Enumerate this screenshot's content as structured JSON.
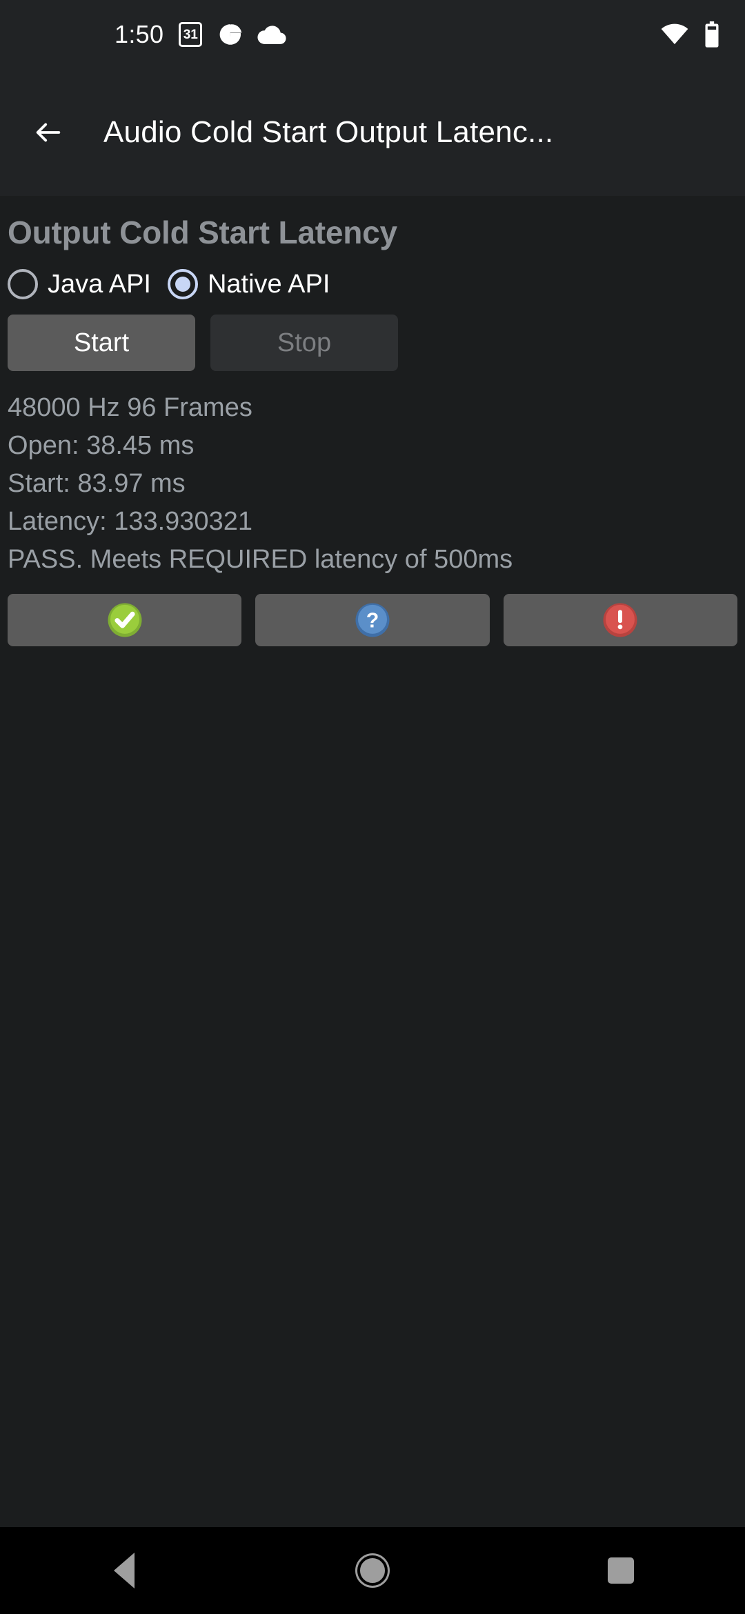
{
  "status_bar": {
    "clock": "1:50",
    "calendar_day": "31",
    "icons": [
      "calendar-icon",
      "google-icon",
      "cloud-icon",
      "wifi-icon",
      "battery-icon"
    ]
  },
  "app_bar": {
    "back_icon": "arrow-back-icon",
    "title": "Audio Cold Start Output Latenc..."
  },
  "main": {
    "heading": "Output Cold Start Latency",
    "radio_group": {
      "selected": "Native API",
      "options": [
        {
          "label": "Java API",
          "selected": false
        },
        {
          "label": "Native API",
          "selected": true
        }
      ]
    },
    "buttons": [
      {
        "label": "Start",
        "enabled": true
      },
      {
        "label": "Stop",
        "enabled": false
      }
    ],
    "results": [
      "48000 Hz 96 Frames",
      "Open: 38.45 ms",
      "Start: 83.97 ms",
      "Latency: 133.930321",
      "PASS. Meets REQUIRED latency of 500ms"
    ],
    "icon_buttons": [
      {
        "icon": "check-circle-icon",
        "color": "#8cc63f"
      },
      {
        "icon": "question-circle-icon",
        "color": "#5b8fc9"
      },
      {
        "icon": "warning-circle-icon",
        "color": "#d9534f"
      }
    ]
  },
  "nav_bar": {
    "items": [
      "back-nav-icon",
      "home-nav-icon",
      "recents-nav-icon"
    ]
  }
}
